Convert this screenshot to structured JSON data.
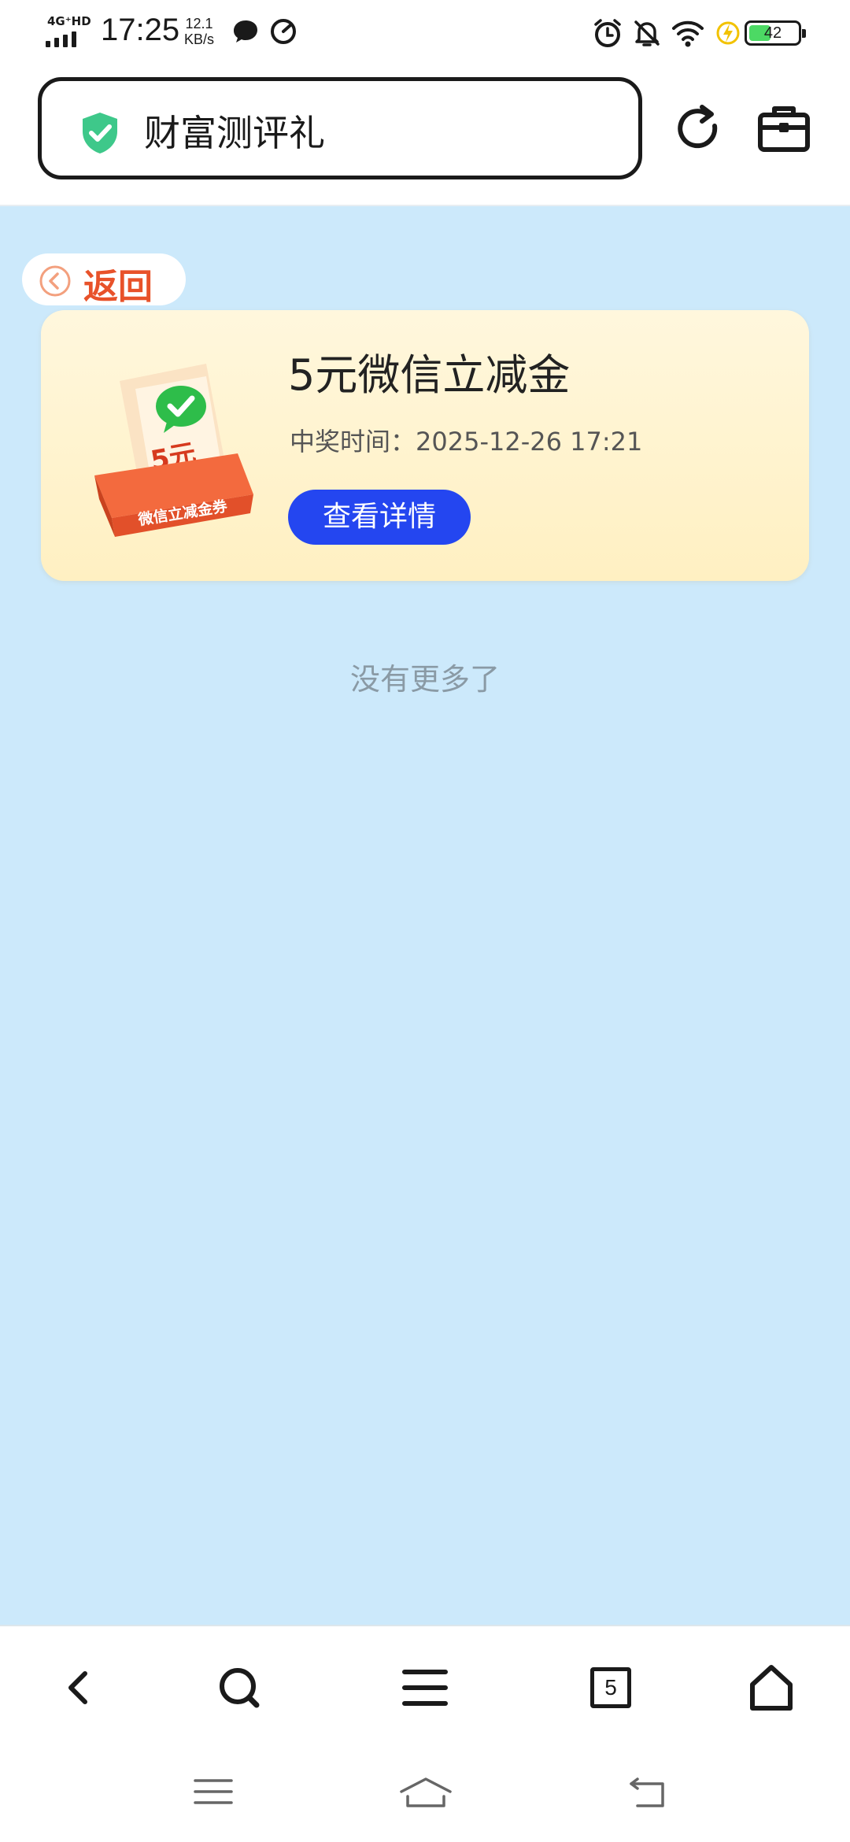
{
  "status_bar": {
    "network": "4G⁺HD",
    "time": "17:25",
    "speed_value": "12.1",
    "speed_unit": "KB/s",
    "battery": "42"
  },
  "address_bar": {
    "title": "财富测评礼"
  },
  "back_label": "返回",
  "prize": {
    "title": "5元微信立减金",
    "time_label": "中奖时间：",
    "time_value": "2025-12-26 17:21",
    "button_label": "查看详情",
    "image_amount": "5元",
    "image_caption": "微信立减金券"
  },
  "footer_text": "没有更多了",
  "bottom_nav": {
    "tab_count": "5"
  },
  "colors": {
    "page_bg": "#cce9fb",
    "accent_blue": "#2446f0",
    "back_orange": "#e8522a",
    "shield_green": "#3ec88a"
  }
}
